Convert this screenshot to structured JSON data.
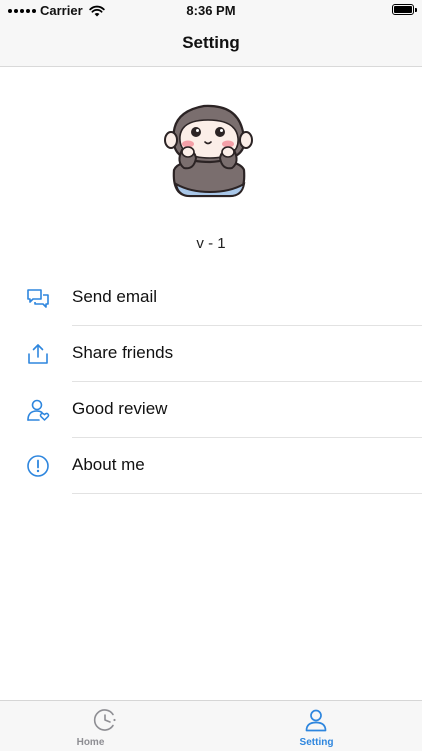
{
  "status_bar": {
    "carrier": "Carrier",
    "time": "8:36 PM"
  },
  "header": {
    "title": "Setting"
  },
  "profile": {
    "version": "v - 1"
  },
  "menu": {
    "items": [
      {
        "label": "Send email",
        "icon": "chat-bubbles-icon"
      },
      {
        "label": "Share friends",
        "icon": "share-icon"
      },
      {
        "label": "Good review",
        "icon": "user-heart-icon"
      },
      {
        "label": "About me",
        "icon": "info-circle-icon"
      }
    ]
  },
  "tab_bar": {
    "tabs": [
      {
        "label": "Home",
        "icon": "pacman-clock-icon",
        "active": false
      },
      {
        "label": "Setting",
        "icon": "user-icon",
        "active": true
      }
    ]
  },
  "colors": {
    "accent": "#2e86de",
    "inactive": "#8e8e93"
  }
}
